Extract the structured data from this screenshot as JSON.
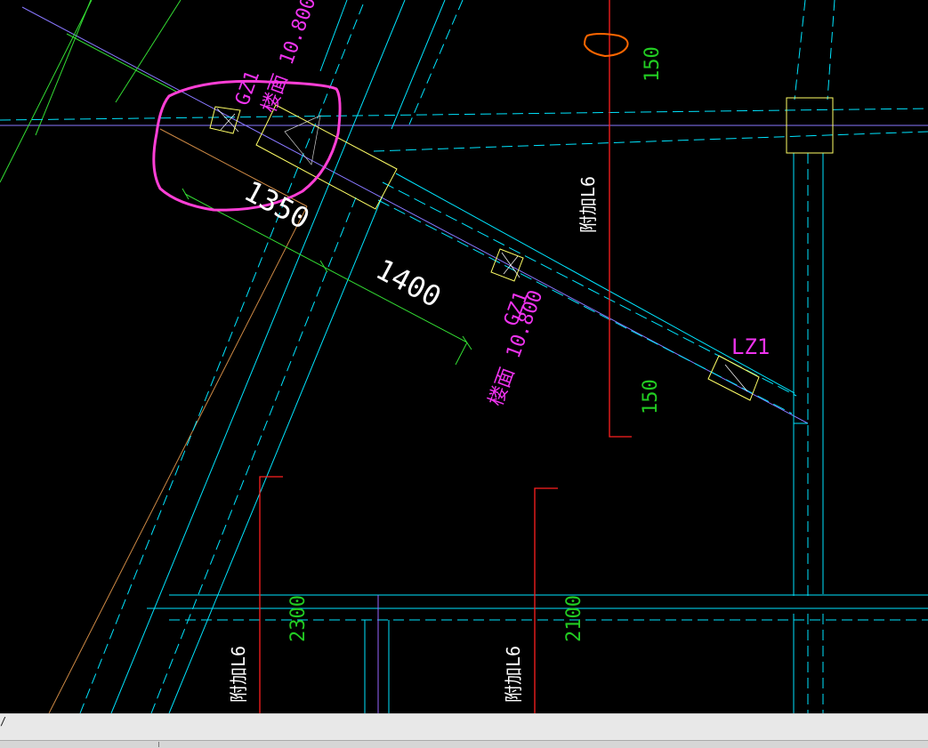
{
  "labels": {
    "dim_150_top": "150",
    "dim_150_bottom": "150",
    "dim_1350": "1350",
    "dim_1400": "1400",
    "dim_2300": "2300",
    "dim_2100": "2100",
    "tag_gz1_top": "GZ1",
    "elev_top": "楼面 10.800",
    "tag_gz1_mid": "GZ1",
    "elev_mid": "楼面 10.800",
    "tag_lz1": "LZ1",
    "note_fujia_right": "附加L6",
    "note_fujia_left": "附加L6",
    "note_fujia_mid": "附加L6"
  },
  "colors": {
    "background": "#000000",
    "cyan": "#00ffff",
    "magenta": "#ff00ff",
    "green": "#00cc00",
    "red": "#ff0000",
    "yellow": "#ffff66",
    "white": "#ffffff",
    "purple": "#9966ff",
    "orange": "#ff6600",
    "tan": "#cc8844"
  },
  "command": {
    "prompt": "/"
  }
}
